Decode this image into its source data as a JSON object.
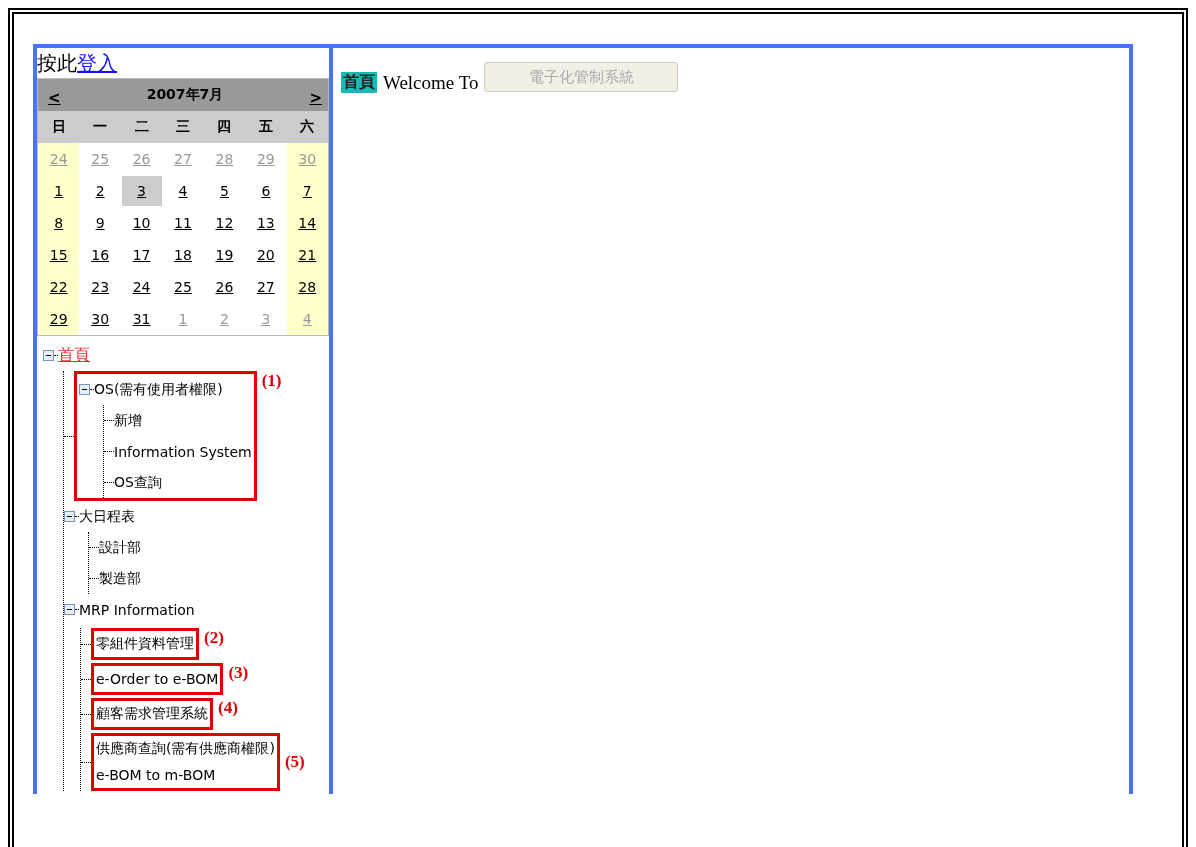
{
  "login": {
    "prefix": "按此",
    "link": "登入"
  },
  "calendar": {
    "prev": "<",
    "next": ">",
    "title": "2007年7月",
    "weekdays": [
      "日",
      "一",
      "二",
      "三",
      "四",
      "五",
      "六"
    ],
    "weeks": [
      [
        {
          "day": "24",
          "other_month": true,
          "weekend": true,
          "selected": false
        },
        {
          "day": "25",
          "other_month": true,
          "weekend": false,
          "selected": false
        },
        {
          "day": "26",
          "other_month": true,
          "weekend": false,
          "selected": false
        },
        {
          "day": "27",
          "other_month": true,
          "weekend": false,
          "selected": false
        },
        {
          "day": "28",
          "other_month": true,
          "weekend": false,
          "selected": false
        },
        {
          "day": "29",
          "other_month": true,
          "weekend": false,
          "selected": false
        },
        {
          "day": "30",
          "other_month": true,
          "weekend": true,
          "selected": false
        }
      ],
      [
        {
          "day": "1",
          "other_month": false,
          "weekend": true,
          "selected": false
        },
        {
          "day": "2",
          "other_month": false,
          "weekend": false,
          "selected": false
        },
        {
          "day": "3",
          "other_month": false,
          "weekend": false,
          "selected": true
        },
        {
          "day": "4",
          "other_month": false,
          "weekend": false,
          "selected": false
        },
        {
          "day": "5",
          "other_month": false,
          "weekend": false,
          "selected": false
        },
        {
          "day": "6",
          "other_month": false,
          "weekend": false,
          "selected": false
        },
        {
          "day": "7",
          "other_month": false,
          "weekend": true,
          "selected": false
        }
      ],
      [
        {
          "day": "8",
          "other_month": false,
          "weekend": true,
          "selected": false
        },
        {
          "day": "9",
          "other_month": false,
          "weekend": false,
          "selected": false
        },
        {
          "day": "10",
          "other_month": false,
          "weekend": false,
          "selected": false
        },
        {
          "day": "11",
          "other_month": false,
          "weekend": false,
          "selected": false
        },
        {
          "day": "12",
          "other_month": false,
          "weekend": false,
          "selected": false
        },
        {
          "day": "13",
          "other_month": false,
          "weekend": false,
          "selected": false
        },
        {
          "day": "14",
          "other_month": false,
          "weekend": true,
          "selected": false
        }
      ],
      [
        {
          "day": "15",
          "other_month": false,
          "weekend": true,
          "selected": false
        },
        {
          "day": "16",
          "other_month": false,
          "weekend": false,
          "selected": false
        },
        {
          "day": "17",
          "other_month": false,
          "weekend": false,
          "selected": false
        },
        {
          "day": "18",
          "other_month": false,
          "weekend": false,
          "selected": false
        },
        {
          "day": "19",
          "other_month": false,
          "weekend": false,
          "selected": false
        },
        {
          "day": "20",
          "other_month": false,
          "weekend": false,
          "selected": false
        },
        {
          "day": "21",
          "other_month": false,
          "weekend": true,
          "selected": false
        }
      ],
      [
        {
          "day": "22",
          "other_month": false,
          "weekend": true,
          "selected": false
        },
        {
          "day": "23",
          "other_month": false,
          "weekend": false,
          "selected": false
        },
        {
          "day": "24",
          "other_month": false,
          "weekend": false,
          "selected": false
        },
        {
          "day": "25",
          "other_month": false,
          "weekend": false,
          "selected": false
        },
        {
          "day": "26",
          "other_month": false,
          "weekend": false,
          "selected": false
        },
        {
          "day": "27",
          "other_month": false,
          "weekend": false,
          "selected": false
        },
        {
          "day": "28",
          "other_month": false,
          "weekend": true,
          "selected": false
        }
      ],
      [
        {
          "day": "29",
          "other_month": false,
          "weekend": true,
          "selected": false
        },
        {
          "day": "30",
          "other_month": false,
          "weekend": false,
          "selected": false
        },
        {
          "day": "31",
          "other_month": false,
          "weekend": false,
          "selected": false
        },
        {
          "day": "1",
          "other_month": true,
          "weekend": false,
          "selected": false
        },
        {
          "day": "2",
          "other_month": true,
          "weekend": false,
          "selected": false
        },
        {
          "day": "3",
          "other_month": true,
          "weekend": false,
          "selected": false
        },
        {
          "day": "4",
          "other_month": true,
          "weekend": true,
          "selected": false
        }
      ]
    ]
  },
  "tree": {
    "kind": "node",
    "label": "首頁",
    "root": true,
    "expanded": true,
    "children": [
      {
        "kind": "callout",
        "label": "(1)",
        "children": [
          {
            "kind": "node",
            "label": "OS(需有使用者權限)",
            "expanded": true,
            "children": [
              {
                "kind": "node",
                "label": "新增"
              },
              {
                "kind": "node",
                "label": "Information System"
              },
              {
                "kind": "node",
                "label": "OS查詢"
              }
            ]
          }
        ]
      },
      {
        "kind": "node",
        "label": "大日程表",
        "expanded": true,
        "children": [
          {
            "kind": "node",
            "label": "設計部"
          },
          {
            "kind": "node",
            "label": "製造部"
          }
        ]
      },
      {
        "kind": "node",
        "label": "MRP Information",
        "expanded": true,
        "children": [
          {
            "kind": "callout",
            "label": "(2)",
            "children": [
              {
                "kind": "node",
                "label": "零組件資料管理"
              }
            ]
          },
          {
            "kind": "callout",
            "label": "(3)",
            "children": [
              {
                "kind": "node",
                "label": "e-Order to e-BOM"
              }
            ]
          },
          {
            "kind": "callout",
            "label": "(4)",
            "children": [
              {
                "kind": "node",
                "label": "顧客需求管理系統"
              }
            ]
          },
          {
            "kind": "callout",
            "label": "(5)",
            "children": [
              {
                "kind": "node",
                "label": "供應商查詢(需有供應商權限)"
              },
              {
                "kind": "node",
                "label": "e-BOM to m-BOM"
              }
            ]
          }
        ]
      }
    ]
  },
  "content": {
    "badge": "首頁",
    "welcome": "Welcome To",
    "system_button": {
      "label": "電子化管制系統",
      "disabled": true
    }
  }
}
